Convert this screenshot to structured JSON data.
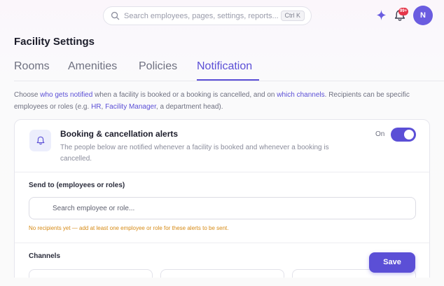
{
  "header": {
    "search_placeholder": "Search employees, pages, settings, reports...",
    "search_shortcut": "Ctrl K",
    "notifications_badge": "99+",
    "avatar_initial": "N"
  },
  "page": {
    "title": "Facility Settings",
    "tabs": [
      {
        "label": "Rooms",
        "active": false
      },
      {
        "label": "Amenities",
        "active": false
      },
      {
        "label": "Policies",
        "active": false
      },
      {
        "label": "Notification",
        "active": true
      }
    ]
  },
  "description": {
    "part1": "Choose ",
    "link1": "who gets notified",
    "part2": " when a facility is booked or a booking is cancelled, and on ",
    "link2": "which channels",
    "part3": ". Recipients can be specific employees or roles (e.g. ",
    "link3": "HR",
    "part4": ", ",
    "link4": "Facility Manager",
    "part5": ", a department head)."
  },
  "alerts": {
    "title": "Booking & cancellation alerts",
    "description": "The people below are notified whenever a facility is booked and whenever a booking is cancelled.",
    "toggle_label": "On",
    "toggle_on": true,
    "send_to_label": "Send to (employees or roles)",
    "recipient_placeholder": "Search employee or role...",
    "warning": "No recipients yet — add at least one employee or role for these alerts to be sent.",
    "channels_label": "Channels"
  },
  "actions": {
    "save_label": "Save"
  },
  "colors": {
    "accent": "#5b4fd6",
    "badge": "#e5364a",
    "warning": "#d68a15"
  }
}
